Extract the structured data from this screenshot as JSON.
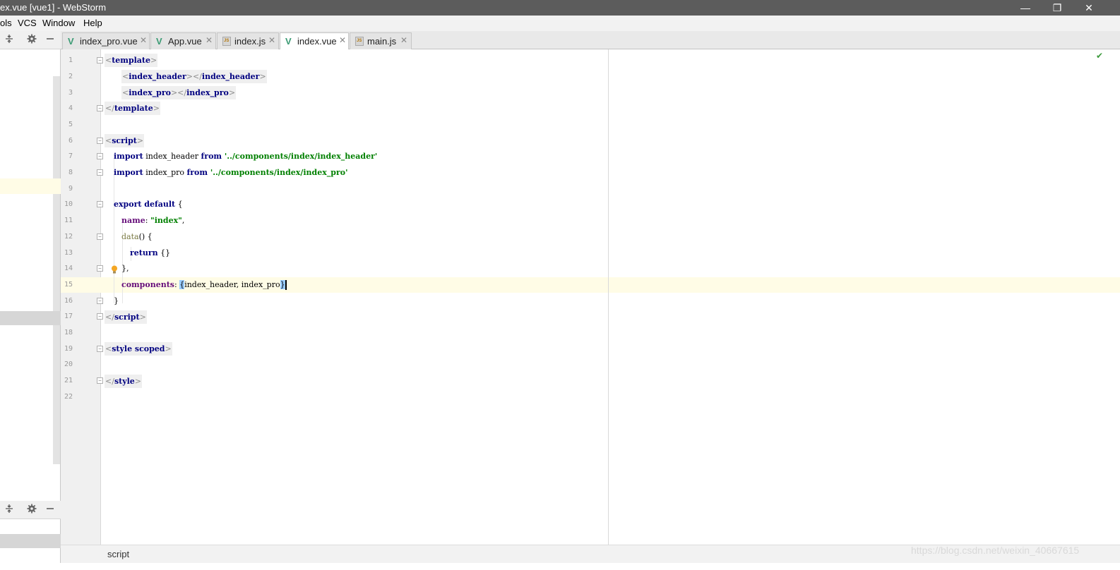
{
  "window": {
    "title": "ex.vue [vue1] - WebStorm",
    "minimize_glyph": "—",
    "maximize_glyph": "❐",
    "close_glyph": "✕"
  },
  "menubar": {
    "items": [
      "ols",
      "VCS",
      "Window",
      "Help"
    ]
  },
  "tabs": [
    {
      "label": "index_pro.vue",
      "type": "vue",
      "active": false
    },
    {
      "label": "App.vue",
      "type": "vue",
      "active": false
    },
    {
      "label": "index.js",
      "type": "js",
      "active": false
    },
    {
      "label": "index.vue",
      "type": "vue",
      "active": true
    },
    {
      "label": "main.js",
      "type": "js",
      "active": false
    }
  ],
  "editor": {
    "line_numbers": [
      "1",
      "2",
      "3",
      "4",
      "5",
      "6",
      "7",
      "8",
      "9",
      "10",
      "11",
      "12",
      "13",
      "14",
      "15",
      "16",
      "17",
      "18",
      "19",
      "20",
      "21",
      "22"
    ],
    "current_line": "15",
    "lines": {
      "l1": {
        "open": "<",
        "name": "template",
        "close": ">"
      },
      "l2": {
        "open1": "<",
        "name1": "index_header",
        "mid": "></",
        "name2": "index_header",
        "close": ">"
      },
      "l3": {
        "open1": "<",
        "name1": "index_pro",
        "mid": "></",
        "name2": "index_pro",
        "close": ">"
      },
      "l4": {
        "open": "</",
        "name": "template",
        "close": ">"
      },
      "l6": {
        "open": "<",
        "name": "script",
        "close": ">"
      },
      "l7": {
        "kw1": "import",
        "ident": " index_header ",
        "kw2": "from",
        "str": " '../components/index/index_header'"
      },
      "l8": {
        "kw1": "import",
        "ident": " index_pro ",
        "kw2": "from",
        "str": " '../components/index/index_pro'"
      },
      "l10": {
        "kw1": "export",
        "kw2": " default",
        "rest": " {"
      },
      "l11": {
        "prop": "name",
        "colon": ": ",
        "str": "\"index\"",
        "comma": ","
      },
      "l12": {
        "fn": "data",
        "rest": "() {"
      },
      "l13": {
        "kw": "return",
        "rest": " {}"
      },
      "l14": {
        "text": "},"
      },
      "l15": {
        "prop": "components",
        "colon": ": ",
        "lbrace": "{",
        "inner": "index_header, index_pro",
        "rbrace": "}"
      },
      "l16": {
        "text": "}"
      },
      "l17": {
        "open": "</",
        "name": "script",
        "close": ">"
      },
      "l19": {
        "open": "<",
        "name": "style scoped",
        "close": ">"
      },
      "l21": {
        "open": "</",
        "name": "style",
        "close": ">"
      }
    }
  },
  "breadcrumb": {
    "text": "script"
  },
  "watermark": "https://blog.csdn.net/weixin_40667615",
  "colors": {
    "keyword": "#000080",
    "string": "#008000",
    "property": "#660e7a",
    "current_line": "#fffce6",
    "titlebar": "#5c5c5c"
  },
  "icons": {
    "vue_tab": "vue-file-icon",
    "js_tab": "js-file-icon",
    "inspection_ok": "check-icon",
    "intention": "lightbulb-icon"
  }
}
